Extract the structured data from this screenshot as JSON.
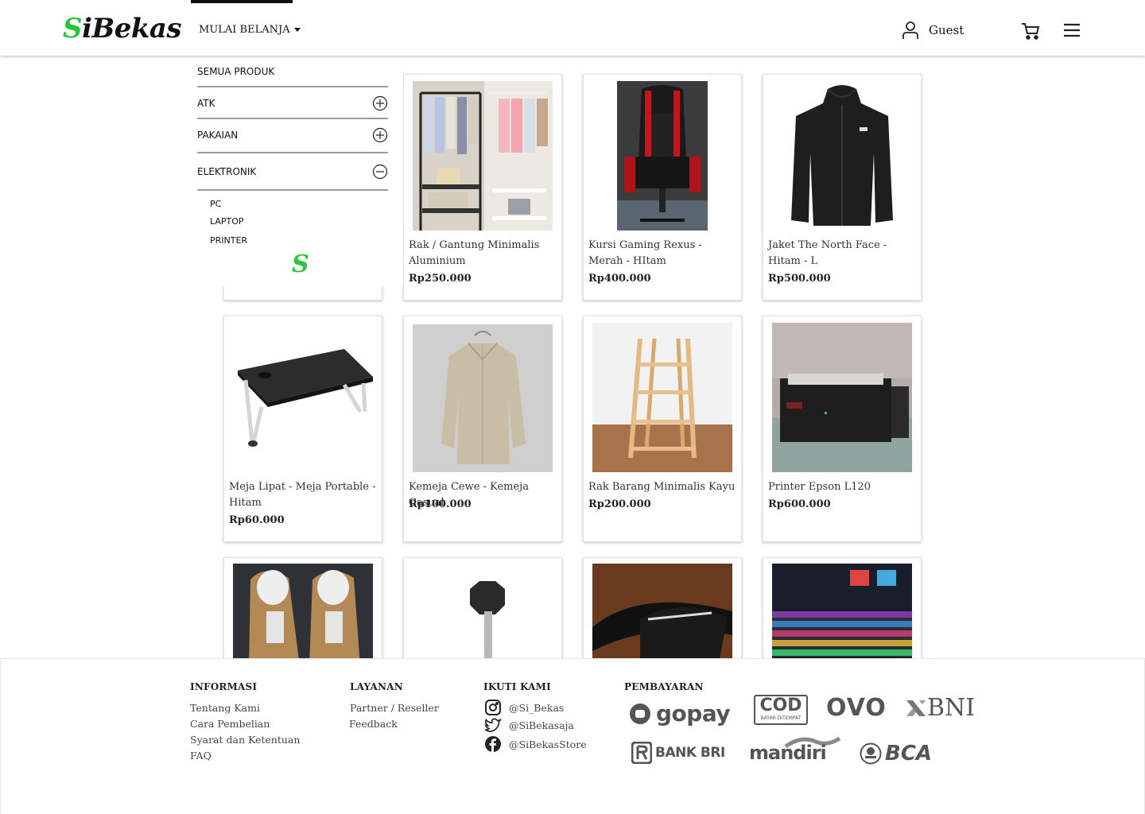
{
  "header": {
    "logo_first": "S",
    "logo_rest": "iBekas",
    "menu_label": "MULAI BELANJA",
    "user_name": "Guest"
  },
  "dropdown": {
    "all_products": "SEMUA PRODUK",
    "categories": [
      {
        "label": "ATK",
        "state": "collapsed"
      },
      {
        "label": "PAKAIAN",
        "state": "collapsed"
      },
      {
        "label": "ELEKTRONIK",
        "state": "expanded"
      }
    ],
    "sub_items": [
      "PC",
      "LAPTOP",
      "PRINTER"
    ],
    "logo_mark": "S"
  },
  "products": [
    {
      "title": "Rak / Gantung Minimalis Aluminium",
      "price": "Rp250.000"
    },
    {
      "title": "Kursi Gaming Rexus - Merah - HItam",
      "price": "Rp400.000"
    },
    {
      "title": "Jaket The North Face - Hitam - L",
      "price": "Rp500.000"
    },
    {
      "title": "Meja Lipat - Meja Portable - Hitam",
      "price": "Rp60.000"
    },
    {
      "title": "Kemeja Cewe - Kemeja Casual",
      "price": "Rp100.000"
    },
    {
      "title": "Rak Barang Minimalis Kayu",
      "price": "Rp200.000"
    },
    {
      "title": "Printer Epson L120",
      "price": "Rp600.000"
    }
  ],
  "footer": {
    "informasi": {
      "heading": "INFORMASI",
      "links": [
        "Tentang Kami",
        "Cara Pembelian",
        "Syarat dan Ketentuan",
        "FAQ"
      ]
    },
    "layanan": {
      "heading": "LAYANAN",
      "links": [
        "Partner / Reseller",
        "Feedback"
      ]
    },
    "ikuti": {
      "heading": "IKUTI KAMI",
      "instagram": "@Si_Bekas",
      "twitter": "@SiBekasaja",
      "facebook": "@SiBekasStore"
    },
    "pembayaran": {
      "heading": "PEMBAYARAN",
      "gopay": "gopay",
      "cod": "COD",
      "cod_sub": "BAYAR DITEMPAT",
      "ovo": "OVO",
      "bni": "BNI",
      "bri": "BANK BRI",
      "mandiri": "mandiri",
      "bca": "BCA"
    }
  },
  "colors": {
    "brand_green": "#2cc43b",
    "text_dark": "#111111",
    "divider": "#9a9a9a"
  }
}
